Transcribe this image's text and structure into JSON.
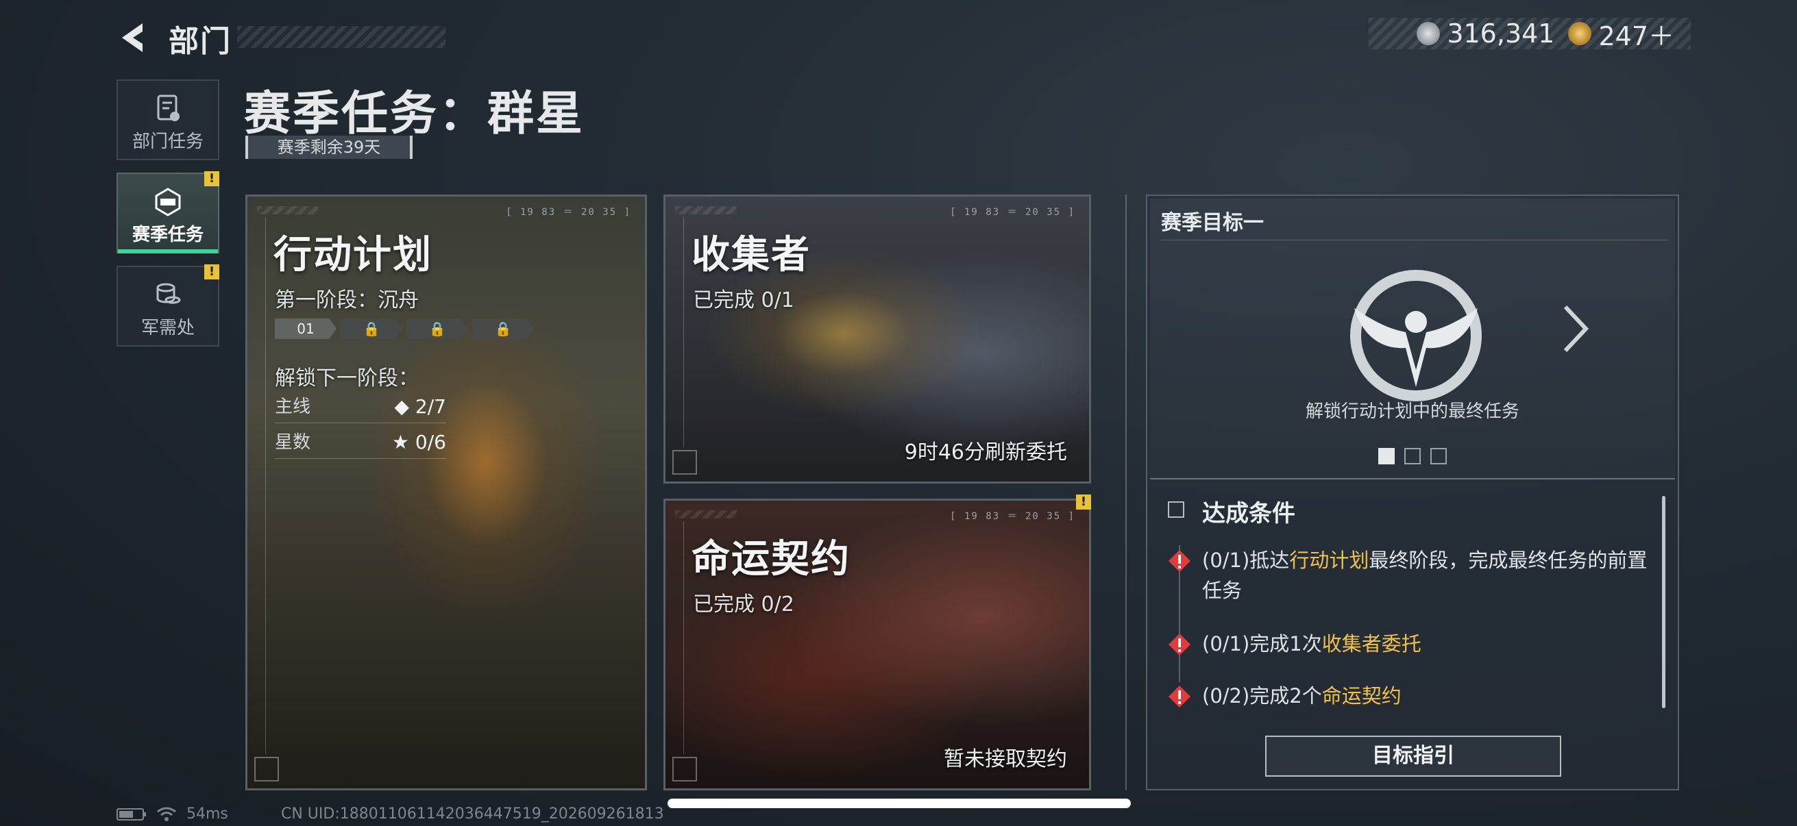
{
  "header": {
    "title": "部门"
  },
  "currency": [
    {
      "name": "silver-coin",
      "value": "316,341",
      "color": "#b9bfc4"
    },
    {
      "name": "gold-coin",
      "value": "247＋",
      "color": "#d4a640"
    }
  ],
  "nav": [
    {
      "label": "部门任务",
      "icon": "task-document-icon",
      "active": false,
      "alert": false
    },
    {
      "label": "赛季任务",
      "icon": "season-task-icon",
      "active": true,
      "alert": true
    },
    {
      "label": "军需处",
      "icon": "coins-stack-icon",
      "active": false,
      "alert": true
    }
  ],
  "alert_glyph": "!",
  "page_title": "赛季任务：群星",
  "season_remaining": "赛季剩余39天",
  "cards": {
    "code": "[ 19 83 ＝ 20 35 ]",
    "plan": {
      "title": "行动计划",
      "phase": "第一阶段：沉舟",
      "stages": [
        "01",
        "",
        "",
        ""
      ],
      "unlock_label": "解锁下一阶段：",
      "stats": [
        {
          "label": "主线",
          "value": "◆ 2/7"
        },
        {
          "label": "星数",
          "value": "★ 0/6"
        }
      ]
    },
    "collector": {
      "title": "收集者",
      "progress": "已完成 0/1",
      "footer": "9时46分刷新委托"
    },
    "fate": {
      "title": "命运契约",
      "progress": "已完成 0/2",
      "footer": "暂未接取契约"
    }
  },
  "goal": {
    "heading": "赛季目标一",
    "description": "解锁行动计划中的最终任务",
    "page_count": 3,
    "current_page": 1,
    "conditions_title": "达成条件",
    "conditions": [
      {
        "prefix": "(0/1)抵达",
        "highlight": "行动计划",
        "suffix": "最终阶段，完成最终任务的前置任务"
      },
      {
        "prefix": "(0/1)完成1次",
        "highlight": "收集者委托",
        "suffix": ""
      },
      {
        "prefix": "(0/2)完成2个",
        "highlight": "命运契约",
        "suffix": ""
      }
    ],
    "guide_button": "目标指引"
  },
  "status": {
    "ping": "54ms",
    "uid": "CN UID:18801106114203644751­9_202609261813"
  },
  "colors": {
    "accent_green": "#3fd39a",
    "alert_yellow": "#e8c23a",
    "highlight": "#f2c14a",
    "warn_red": "#e23b3b"
  }
}
